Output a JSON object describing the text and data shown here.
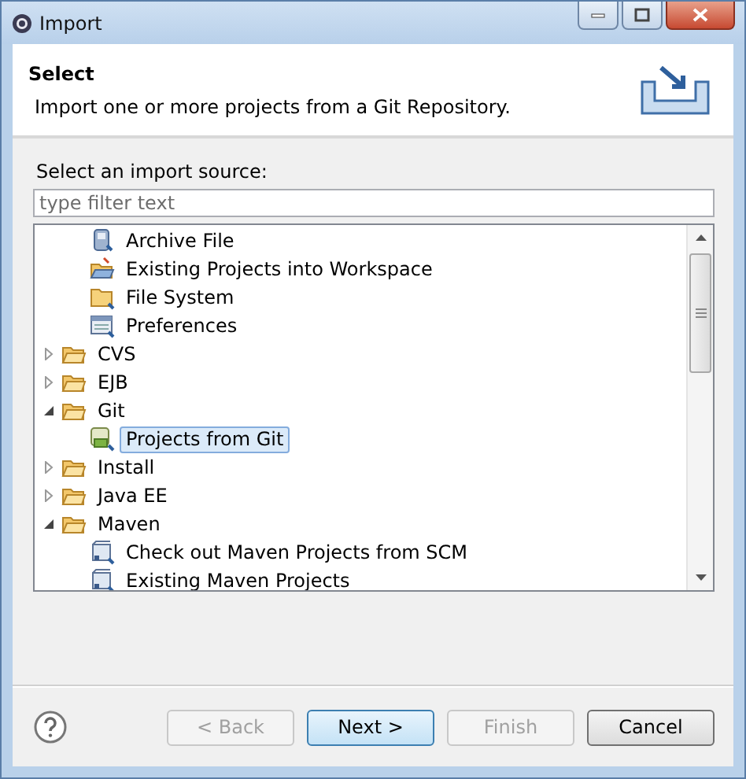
{
  "window": {
    "title": "Import"
  },
  "header": {
    "title": "Select",
    "description": "Import one or more projects from a Git Repository."
  },
  "source_label": "Select an import source:",
  "filter": {
    "placeholder": "type filter text"
  },
  "tree": [
    {
      "children": [
        {
          "label": "Archive File",
          "kind": "archive",
          "selected": false
        },
        {
          "label": "Existing Projects into Workspace",
          "kind": "projects",
          "selected": false
        },
        {
          "label": "File System",
          "kind": "filesystem",
          "selected": false
        },
        {
          "label": "Preferences",
          "kind": "preferences",
          "selected": false
        }
      ]
    },
    {
      "label": "CVS",
      "kind": "folder",
      "expanded": false,
      "selected": false
    },
    {
      "label": "EJB",
      "kind": "folder",
      "expanded": false,
      "selected": false
    },
    {
      "label": "Git",
      "kind": "folder",
      "expanded": true,
      "selected": false,
      "children": [
        {
          "label": "Projects from Git",
          "kind": "git",
          "selected": true
        }
      ]
    },
    {
      "label": "Install",
      "kind": "folder",
      "expanded": false,
      "selected": false
    },
    {
      "label": "Java EE",
      "kind": "folder",
      "expanded": false,
      "selected": false
    },
    {
      "label": "Maven",
      "kind": "folder",
      "expanded": true,
      "selected": false,
      "children": [
        {
          "label": "Check out Maven Projects from SCM",
          "kind": "maven",
          "selected": false
        },
        {
          "label": "Existing Maven Projects",
          "kind": "maven",
          "selected": false
        }
      ]
    }
  ],
  "buttons": [
    {
      "label": "< Back",
      "disabled": true,
      "default": false
    },
    {
      "label": "Next >",
      "disabled": false,
      "default": true
    },
    {
      "label": "Finish",
      "disabled": true,
      "default": false
    },
    {
      "label": "Cancel",
      "disabled": false,
      "default": false
    }
  ]
}
